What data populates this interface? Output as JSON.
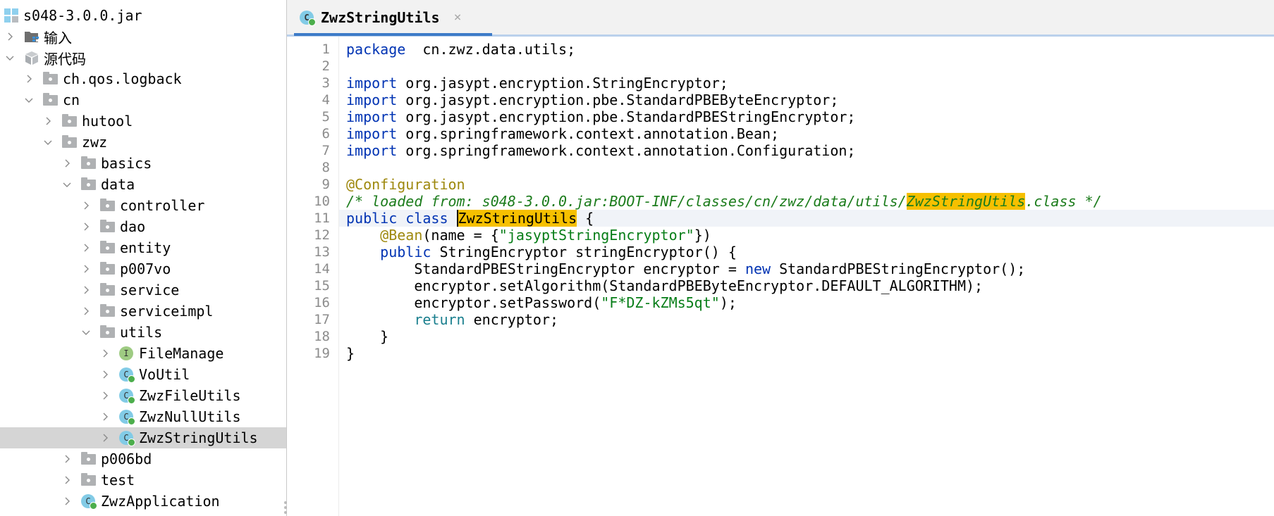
{
  "tree": [
    {
      "label": "s048-3.0.0.jar",
      "level": 0,
      "icon": "jar-icon",
      "chevron": "none"
    },
    {
      "label": "输入",
      "level": 0,
      "icon": "library-folder-icon",
      "chevron": "right"
    },
    {
      "label": "源代码",
      "level": 0,
      "icon": "source-package-icon",
      "chevron": "down"
    },
    {
      "label": "ch.qos.logback",
      "level": 1,
      "icon": "package-folder-icon",
      "chevron": "right"
    },
    {
      "label": "cn",
      "level": 1,
      "icon": "package-folder-icon",
      "chevron": "down"
    },
    {
      "label": "hutool",
      "level": 2,
      "icon": "package-folder-icon",
      "chevron": "right"
    },
    {
      "label": "zwz",
      "level": 2,
      "icon": "package-folder-icon",
      "chevron": "down"
    },
    {
      "label": "basics",
      "level": 3,
      "icon": "package-folder-icon",
      "chevron": "right"
    },
    {
      "label": "data",
      "level": 3,
      "icon": "package-folder-icon",
      "chevron": "down"
    },
    {
      "label": "controller",
      "level": 4,
      "icon": "package-folder-icon",
      "chevron": "right"
    },
    {
      "label": "dao",
      "level": 4,
      "icon": "package-folder-icon",
      "chevron": "right"
    },
    {
      "label": "entity",
      "level": 4,
      "icon": "package-folder-icon",
      "chevron": "right"
    },
    {
      "label": "p007vo",
      "level": 4,
      "icon": "package-folder-icon",
      "chevron": "right"
    },
    {
      "label": "service",
      "level": 4,
      "icon": "package-folder-icon",
      "chevron": "right"
    },
    {
      "label": "serviceimpl",
      "level": 4,
      "icon": "package-folder-icon",
      "chevron": "right"
    },
    {
      "label": "utils",
      "level": 4,
      "icon": "package-folder-icon",
      "chevron": "down"
    },
    {
      "label": "FileManage",
      "level": 5,
      "icon": "interface-icon",
      "chevron": "right",
      "glyph": "I"
    },
    {
      "label": "VoUtil",
      "level": 5,
      "icon": "class-icon",
      "chevron": "right",
      "glyph": "C"
    },
    {
      "label": "ZwzFileUtils",
      "level": 5,
      "icon": "class-icon",
      "chevron": "right",
      "glyph": "C"
    },
    {
      "label": "ZwzNullUtils",
      "level": 5,
      "icon": "class-icon",
      "chevron": "right",
      "glyph": "C"
    },
    {
      "label": "ZwzStringUtils",
      "level": 5,
      "icon": "class-icon",
      "chevron": "right",
      "glyph": "C",
      "selected": true
    },
    {
      "label": "p006bd",
      "level": 3,
      "icon": "package-folder-icon",
      "chevron": "right"
    },
    {
      "label": "test",
      "level": 3,
      "icon": "package-folder-icon",
      "chevron": "right"
    },
    {
      "label": "ZwzApplication",
      "level": 3,
      "icon": "class-icon",
      "chevron": "right",
      "glyph": "C"
    }
  ],
  "tab": {
    "label": "ZwzStringUtils",
    "icon_glyph": "C",
    "close": "×"
  },
  "editor": {
    "current_line": 11,
    "lines": [
      [
        [
          "kw",
          "package"
        ],
        [
          "",
          "  cn.zwz.data.utils;"
        ]
      ],
      [],
      [
        [
          "kw",
          "import"
        ],
        [
          "",
          " org.jasypt.encryption.StringEncryptor;"
        ]
      ],
      [
        [
          "kw",
          "import"
        ],
        [
          "",
          " org.jasypt.encryption.pbe.StandardPBEByteEncryptor;"
        ]
      ],
      [
        [
          "kw",
          "import"
        ],
        [
          "",
          " org.jasypt.encryption.pbe.StandardPBEStringEncryptor;"
        ]
      ],
      [
        [
          "kw",
          "import"
        ],
        [
          "",
          " org.springframework.context.annotation.Bean;"
        ]
      ],
      [
        [
          "kw",
          "import"
        ],
        [
          "",
          " org.springframework.context.annotation.Configuration;"
        ]
      ],
      [],
      [
        [
          "ann",
          "@Configuration"
        ]
      ],
      [
        [
          "cmt",
          "/* loaded from: s048-3.0.0.jar:BOOT-INF/classes/cn/zwz/data/utils/"
        ],
        [
          "cmt hl",
          "ZwzStringUtils"
        ],
        [
          "cmt",
          ".class */"
        ]
      ],
      [
        [
          "kw",
          "public class "
        ],
        [
          "hl caret",
          "ZwzStringUtils"
        ],
        [
          "",
          " {"
        ]
      ],
      [
        [
          "",
          "    "
        ],
        [
          "ann",
          "@Bean"
        ],
        [
          "",
          "(name = {"
        ],
        [
          "str",
          "\"jasyptStringEncryptor\""
        ],
        [
          "",
          "})"
        ]
      ],
      [
        [
          "",
          "    "
        ],
        [
          "kw",
          "public"
        ],
        [
          "",
          " StringEncryptor stringEncryptor() {"
        ]
      ],
      [
        [
          "",
          "        StandardPBEStringEncryptor encryptor = "
        ],
        [
          "kw",
          "new"
        ],
        [
          "",
          " StandardPBEStringEncryptor();"
        ]
      ],
      [
        [
          "",
          "        encryptor.setAlgorithm(StandardPBEByteEncryptor.DEFAULT_ALGORITHM);"
        ]
      ],
      [
        [
          "",
          "        encryptor.setPassword("
        ],
        [
          "str",
          "\"F*DZ-kZMs5qt\""
        ],
        [
          "",
          ");"
        ]
      ],
      [
        [
          "",
          "        "
        ],
        [
          "kw2",
          "return"
        ],
        [
          "",
          " encryptor;"
        ]
      ],
      [
        [
          "",
          "    }"
        ]
      ],
      [
        [
          "",
          "}"
        ]
      ]
    ]
  }
}
